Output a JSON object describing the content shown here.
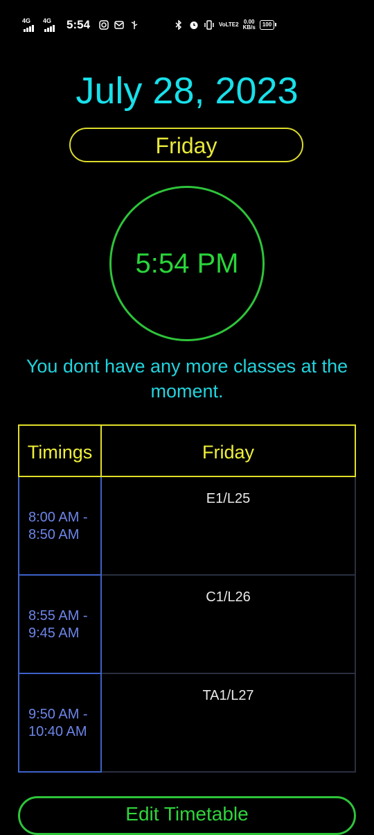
{
  "status_bar": {
    "net1": "4G",
    "net2": "4G",
    "time": "5:54",
    "volte": "VoLTE2",
    "speed_value": "0.00",
    "speed_unit": "KB/s",
    "battery": "100"
  },
  "date": "July 28, 2023",
  "day": "Friday",
  "clock": "5:54 PM",
  "message": "You dont have any more classes at the moment.",
  "timetable": {
    "headers": {
      "timings": "Timings",
      "day": "Friday"
    },
    "rows": [
      {
        "time": "8:00 AM - 8:50 AM",
        "class": "E1/L25"
      },
      {
        "time": "8:55 AM - 9:45 AM",
        "class": "C1/L26"
      },
      {
        "time": "9:50 AM - 10:40 AM",
        "class": "TA1/L27"
      }
    ]
  },
  "edit_button": "Edit Timetable",
  "colors": {
    "date": "#18e0ea",
    "day": "#e8e83a",
    "clock": "#29d63a",
    "message": "#22d3dd",
    "timing_text": "#6d85e8",
    "button": "#2fd43c"
  }
}
